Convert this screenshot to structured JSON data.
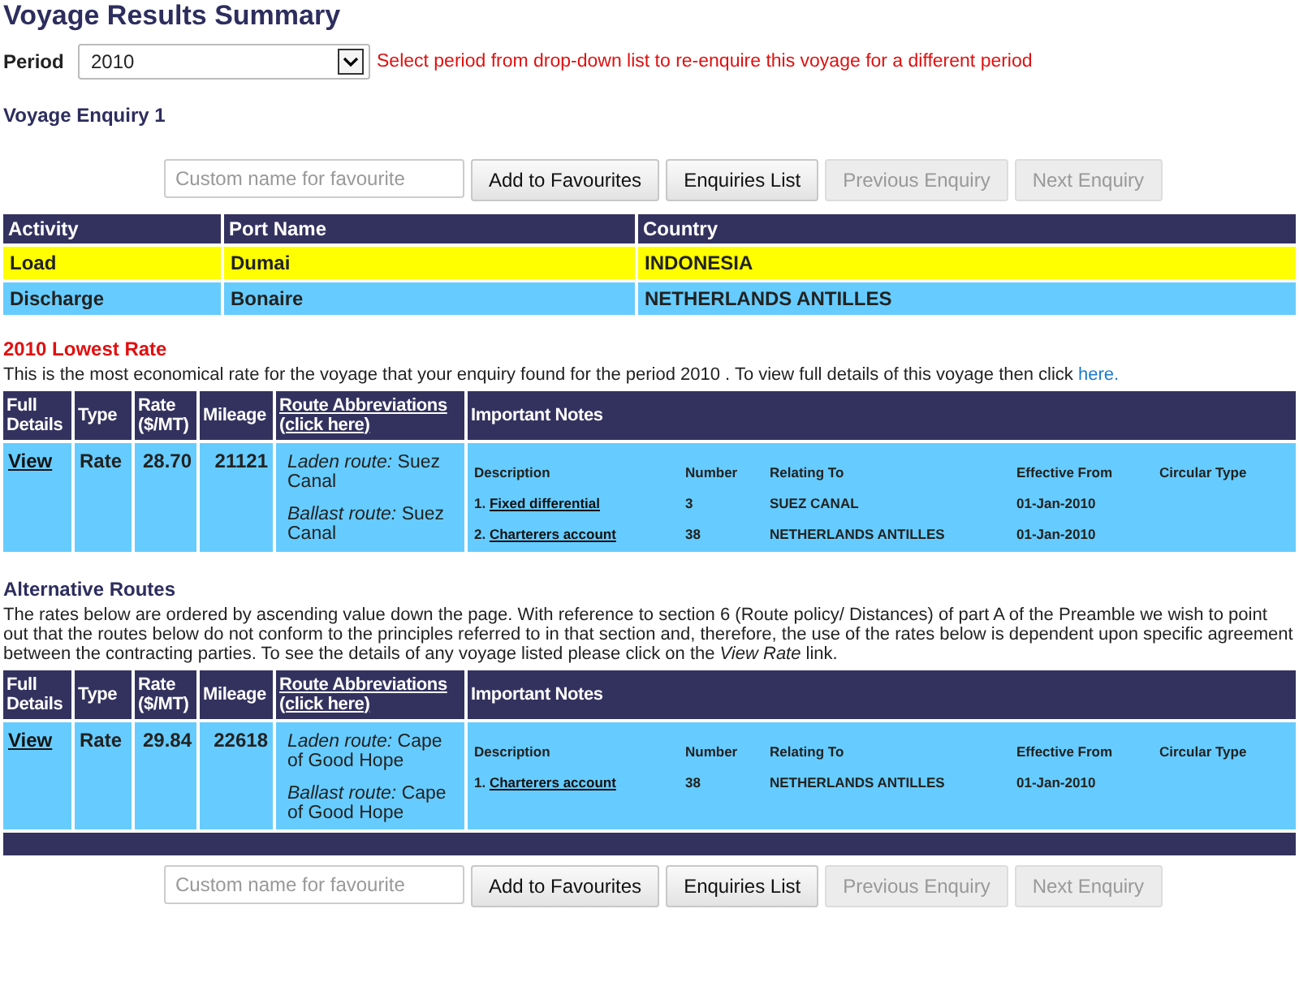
{
  "title": "Voyage Results Summary",
  "period": {
    "label": "Period",
    "value": "2010",
    "hint": "Select period from drop-down list to re-enquire this voyage for a different period"
  },
  "enquiry_title": "Voyage Enquiry 1",
  "toolbars": [
    {
      "placeholder": "Custom name for favourite",
      "buttons": [
        {
          "label": "Add to Favourites",
          "disabled": false
        },
        {
          "label": "Enquiries List",
          "disabled": false
        },
        {
          "label": "Previous Enquiry",
          "disabled": true
        },
        {
          "label": "Next Enquiry",
          "disabled": true
        }
      ]
    },
    {
      "placeholder": "Custom name for favourite",
      "buttons": [
        {
          "label": "Add to Favourites",
          "disabled": false
        },
        {
          "label": "Enquiries List",
          "disabled": false
        },
        {
          "label": "Previous Enquiry",
          "disabled": true
        },
        {
          "label": "Next Enquiry",
          "disabled": true
        }
      ]
    }
  ],
  "ports": {
    "columns": [
      "Activity",
      "Port Name",
      "Country"
    ],
    "rows": [
      {
        "activity": "Load",
        "port": "Dumai",
        "country": "INDONESIA",
        "color": "#ffff00"
      },
      {
        "activity": "Discharge",
        "port": "Bonaire",
        "country": "NETHERLANDS ANTILLES",
        "color": "#66ccff"
      }
    ]
  },
  "lowest": {
    "heading": "2010 Lowest Rate",
    "text": "This is the most economical rate for the voyage that your enquiry found for the period 2010 . To view full details of this voyage then click",
    "link": "here."
  },
  "rate_table": {
    "columns": [
      "Full Details",
      "Type",
      "Rate ($/MT)",
      "Mileage",
      "Route Abbreviations (click here)",
      "Important Notes"
    ],
    "note_columns": [
      "Description",
      "Number",
      "Relating To",
      "Effective From",
      "Circular Type"
    ],
    "rows": [
      {
        "link": "View",
        "type": "Rate",
        "rate": "28.70",
        "mileage": "21121",
        "routes": [
          "*Laden route:* Suez Canal",
          "*Ballast route:* Suez Canal"
        ],
        "notes": [
          {
            "index": "1.",
            "description": "Fixed differential",
            "number": "3",
            "relating_to": "SUEZ CANAL",
            "effective_from": "01-Jan-2010"
          },
          {
            "index": "2.",
            "description": "Charterers account",
            "number": "38",
            "relating_to": "NETHERLANDS ANTILLES",
            "effective_from": "01-Jan-2010"
          }
        ]
      }
    ]
  },
  "alternatives": {
    "heading": "Alternative Routes",
    "text": "The rates below are ordered by ascending value down the page. With reference to section 6 (Route policy/ Distances) of part A of the Preamble we wish to point out that the routes below do not conform to the principles referred to in that section and, therefore, the use of the rates below is dependent upon specific agreement between the contracting parties. To see the details of any voyage listed please click on the *View Rate* link.",
    "rate_table": {
      "columns": [
        "Full Details",
        "Type",
        "Rate ($/MT)",
        "Mileage",
        "Route Abbreviations (click here)",
        "Important Notes"
      ],
      "note_columns": [
        "Description",
        "Number",
        "Relating To",
        "Effective From",
        "Circular Type"
      ],
      "rows": [
        {
          "link": "View",
          "type": "Rate",
          "rate": "29.84",
          "mileage": "22618",
          "routes": [
            "*Laden route:* Cape of Good Hope",
            "*Ballast route:* Cape of Good Hope"
          ],
          "notes": [
            {
              "index": "1.",
              "description": "Charterers account",
              "number": "38",
              "relating_to": "NETHERLANDS ANTILLES",
              "effective_from": "01-Jan-2010"
            }
          ]
        }
      ]
    }
  }
}
